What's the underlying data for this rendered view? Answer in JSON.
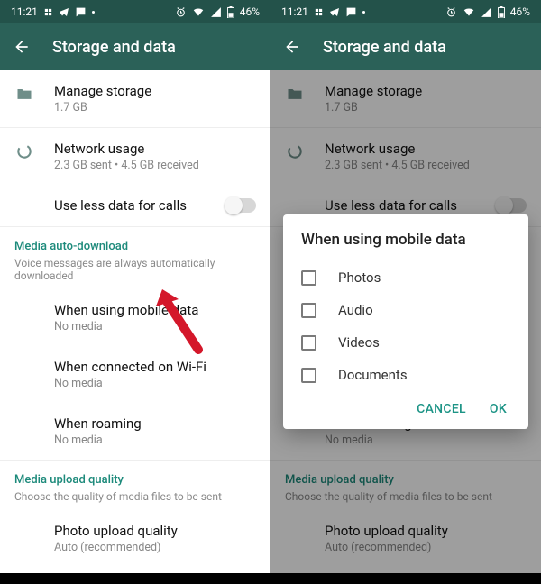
{
  "status": {
    "time": "11:21",
    "battery": "46%"
  },
  "appbar": {
    "title": "Storage and data"
  },
  "storage": {
    "label": "Manage storage",
    "sub": "1.7 GB"
  },
  "network": {
    "label": "Network usage",
    "sub": "2.3 GB sent • 4.5 GB received"
  },
  "lessdata": {
    "label": "Use less data for calls"
  },
  "auto_section": {
    "title": "Media auto-download",
    "sub": "Voice messages are always automatically downloaded"
  },
  "mobile": {
    "label": "When using mobile data",
    "sub": "No media"
  },
  "wifi": {
    "label": "When connected on Wi-Fi",
    "sub": "No media"
  },
  "roaming": {
    "label": "When roaming",
    "sub": "No media"
  },
  "upload_section": {
    "title": "Media upload quality",
    "sub": "Choose the quality of media files to be sent"
  },
  "photo_quality": {
    "label": "Photo upload quality",
    "sub": "Auto (recommended)"
  },
  "dialog": {
    "title": "When using mobile data",
    "opts": {
      "photos": "Photos",
      "audio": "Audio",
      "videos": "Videos",
      "documents": "Documents"
    },
    "cancel": "CANCEL",
    "ok": "OK"
  }
}
